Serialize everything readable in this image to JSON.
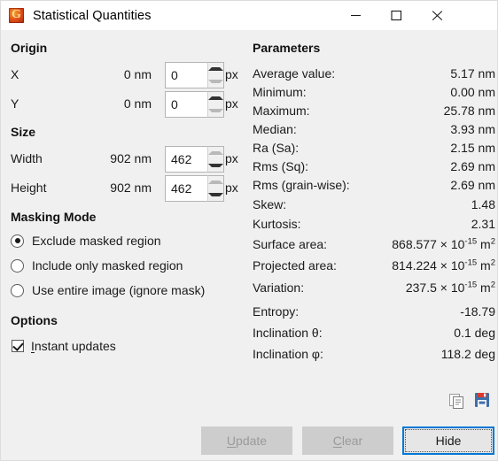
{
  "window": {
    "title": "Statistical Quantities",
    "app_icon": "gwyddion-icon",
    "controls": {
      "minimize": "minimize-icon",
      "maximize": "maximize-icon",
      "close": "close-icon"
    }
  },
  "origin": {
    "heading": "Origin",
    "rows": [
      {
        "label": "X",
        "real": "0 nm",
        "px_value": "0",
        "unit": "px"
      },
      {
        "label": "Y",
        "real": "0 nm",
        "px_value": "0",
        "unit": "px"
      }
    ]
  },
  "size": {
    "heading": "Size",
    "rows": [
      {
        "label": "Width",
        "real": "902 nm",
        "px_value": "462",
        "unit": "px"
      },
      {
        "label": "Height",
        "real": "902 nm",
        "px_value": "462",
        "unit": "px"
      }
    ]
  },
  "masking": {
    "heading": "Masking Mode",
    "options": [
      {
        "label": "Exclude masked region",
        "selected": true
      },
      {
        "label": "Include only masked region",
        "selected": false
      },
      {
        "label": "Use entire image (ignore mask)",
        "selected": false
      }
    ]
  },
  "options": {
    "heading": "Options",
    "instant_updates": {
      "mnemonic": "I",
      "label_rest": "nstant updates",
      "checked": true
    }
  },
  "parameters": {
    "heading": "Parameters",
    "rows": [
      {
        "label": "Average value:",
        "value": "5.17 nm"
      },
      {
        "label": "Minimum:",
        "value": "0.00 nm"
      },
      {
        "label": "Maximum:",
        "value": "25.78 nm"
      },
      {
        "label": "Median:",
        "value": "3.93 nm"
      },
      {
        "label": "Ra (Sa):",
        "value": "2.15 nm"
      },
      {
        "label": "Rms (Sq):",
        "value": "2.69 nm"
      },
      {
        "label": "Rms (grain-wise):",
        "value": "2.69 nm"
      },
      {
        "label": "Skew:",
        "value": "1.48"
      },
      {
        "label": "Kurtosis:",
        "value": "2.31"
      },
      {
        "label": "Surface area:",
        "value": "868.577 × 10⁻¹⁵ m²",
        "mantissa": "868.577 × 10",
        "exponent": "-15",
        "suffix": " m",
        "suffix_exp": "2"
      },
      {
        "label": "Projected area:",
        "value": "814.224 × 10⁻¹⁵ m²",
        "mantissa": "814.224 × 10",
        "exponent": "-15",
        "suffix": " m",
        "suffix_exp": "2"
      },
      {
        "label": "Variation:",
        "value": "237.5 × 10⁻¹⁵ m²",
        "mantissa": "237.5 × 10",
        "exponent": "-15",
        "suffix": " m",
        "suffix_exp": "2"
      },
      {
        "label": "Entropy:",
        "value": "-18.79"
      },
      {
        "label": "Inclination θ:",
        "value": "0.1 deg"
      },
      {
        "label": "Inclination φ:",
        "value": "118.2 deg"
      }
    ]
  },
  "toolbar": {
    "copy_icon": "copy-icon",
    "save_icon": "save-floppy-icon"
  },
  "footer": {
    "update": {
      "mnemonic": "U",
      "label_rest": "pdate",
      "enabled": false
    },
    "clear": {
      "mnemonic": "C",
      "label_rest": "lear",
      "enabled": false
    },
    "hide": {
      "label": "Hide",
      "default": true
    }
  },
  "colors": {
    "window_bg": "#f0f0f0",
    "titlebar_bg": "#ffffff",
    "accent": "#0078d7",
    "text": "#1a1a1a",
    "disabled_text": "#9a9a9a",
    "button_bg": "#cdcdcd"
  }
}
